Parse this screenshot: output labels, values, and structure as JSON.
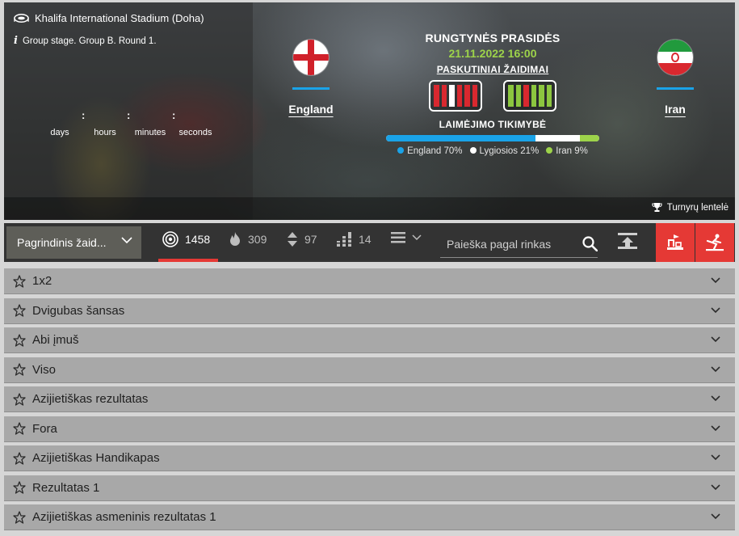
{
  "venue": {
    "icon": "stadium-icon",
    "name": "Khalifa International Stadium (Doha)"
  },
  "round": {
    "icon": "info-icon",
    "text": "Group stage. Group B. Round 1."
  },
  "countdown": {
    "days": "days",
    "hours": "hours",
    "minutes": "minutes",
    "seconds": "seconds"
  },
  "home_team": {
    "name": "England",
    "flag": "england-flag"
  },
  "away_team": {
    "name": "Iran",
    "flag": "iran-flag"
  },
  "match": {
    "start_label": "RUNGTYNĖS PRASIDĖS",
    "date": "21.11.2022 16:00",
    "last_games_label": "PASKUTINIAI ŽAIDIMAI",
    "home_form": [
      "red",
      "red",
      "white",
      "red",
      "red",
      "red"
    ],
    "away_form": [
      "green",
      "green",
      "red",
      "green",
      "green",
      "green"
    ],
    "win_probability_label": "LAIMĖJIMO TIKIMYBĖ",
    "probabilities": [
      {
        "label": "England 70%",
        "value": 70,
        "color": "#1aa3e8"
      },
      {
        "label": "Lygiosios 21%",
        "value": 21,
        "color": "#ffffff"
      },
      {
        "label": "Iran 9%",
        "value": 9,
        "color": "#9dd34a"
      }
    ]
  },
  "tournament_link": {
    "icon": "trophy-icon",
    "label": "Turnyrų lentelė"
  },
  "toolbar": {
    "main_select": "Pagrindinis žaid...",
    "stats": [
      {
        "icon": "target-icon",
        "value": "1458"
      },
      {
        "icon": "fire-icon",
        "value": "309"
      },
      {
        "icon": "updown-icon",
        "value": "97"
      },
      {
        "icon": "bars-icon",
        "value": "14"
      }
    ],
    "search_placeholder": "Paieška pagal rinkas",
    "colors": {
      "accent": "#e53935"
    }
  },
  "markets": [
    "1x2",
    "Dvigubas šansas",
    "Abi įmuš",
    "Viso",
    "Azijietiškas rezultatas",
    "Fora",
    "Azijietiškas Handikapas",
    "Rezultatas 1",
    "Azijietiškas asmeninis rezultatas 1"
  ]
}
